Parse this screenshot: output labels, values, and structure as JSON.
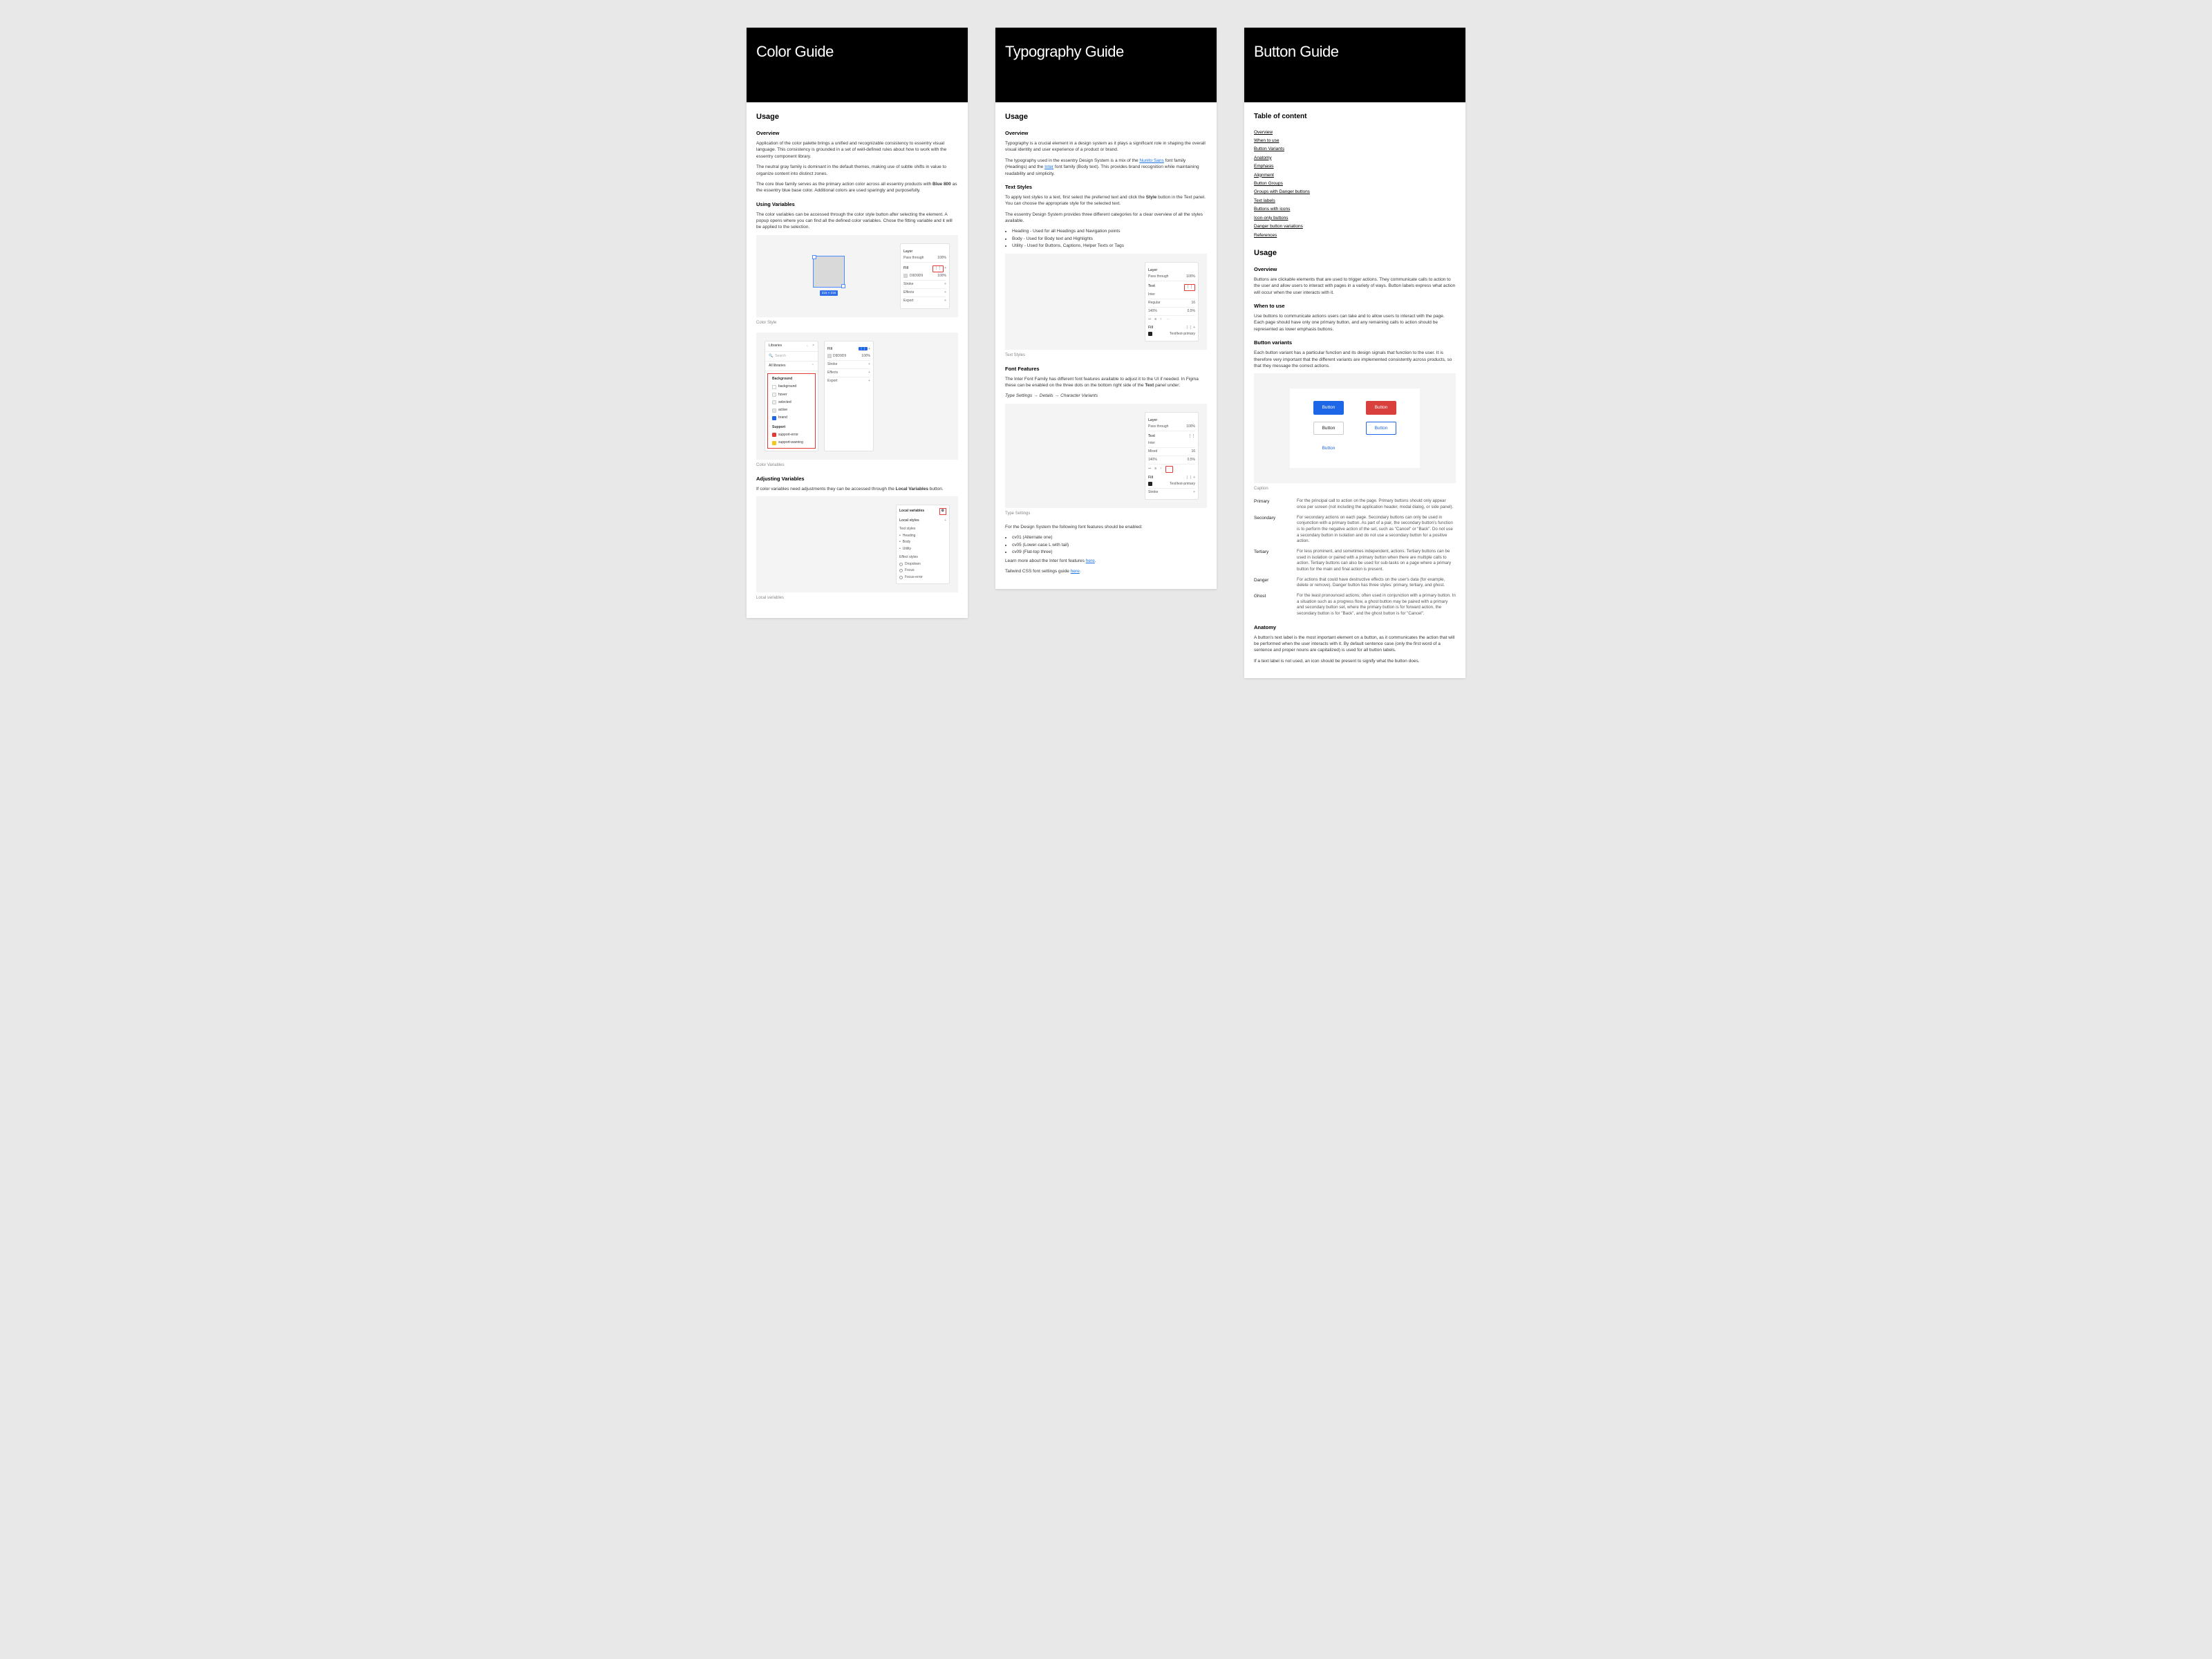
{
  "color": {
    "title": "Color Guide",
    "usage": "Usage",
    "overview_h": "Overview",
    "overview_p1": "Application of the color palette brings a unified and recognizable consistency to essentry visual language. This consistency is grounded in a set of well-defined rules about how to work with the essentry component library.",
    "overview_p2": "The neutral gray family is dominant in the default themes, making use of subtle shifts in value to organize content into distinct zones.",
    "overview_p3a": "The core blue family serves as the primary action color across all essentry products with ",
    "overview_p3b": "Blue 800",
    "overview_p3c": " as the essentry blue base color. Additional colors are used sparingly and purposefully.",
    "using_vars_h": "Using Variables",
    "using_vars_p": "The color variables can be accessed through the color style button after selecting the element. A popup opens where you can find all the defined color variables. Chose the fitting variable and it will be applied to the selection.",
    "panel1": {
      "layer": "Layer",
      "passthrough": "Pass through",
      "pct": "100%",
      "fill": "Fill",
      "hex": "D9D9D9",
      "stroke": "Stroke",
      "effects": "Effects",
      "export": "Export",
      "size": "216 × 216"
    },
    "cap1": "Color Style",
    "lib": {
      "tab1": "Libraries",
      "search": "Search",
      "all": "All libraries",
      "bg": "Background",
      "items": [
        "background",
        "hover",
        "selected",
        "active",
        "brand"
      ],
      "support": "Support",
      "s1": "support-error",
      "s2": "support-warning",
      "fill": "Fill",
      "stroke": "Stroke",
      "effects": "Effects",
      "export": "Export"
    },
    "cap2": "Color Variables",
    "adjust_h": "Adjusting Variables",
    "adjust_p_a": "If color variables need adjustments they can be accessed through the ",
    "adjust_p_b": "Local Variables",
    "adjust_p_c": " button.",
    "lv": {
      "title": "Local variables",
      "styles": "Local styles",
      "text": "Text styles",
      "t1": "Heading",
      "t2": "Body",
      "t3": "Utility",
      "eff": "Effect styles",
      "e1": "Dropdown",
      "e2": "Focus",
      "e3": "Focus-error"
    },
    "cap3": "Local variables"
  },
  "typo": {
    "title": "Typography Guide",
    "usage": "Usage",
    "overview_h": "Overview",
    "overview_p": "Typography is a crucial element in a design system as it plays a significant role in shaping the overall visual identity and user experience of a product or brand.",
    "p2a": "The typography used in the essentry Design System is a mix of the ",
    "p2_link1": "Nunito Sans",
    "p2b": " font family (Headings) and the ",
    "p2_link2": "Inter",
    "p2c": " font family (Body text). This provides brand recognition while maintaining readability and simplicity.",
    "textstyles_h": "Text Styles",
    "ts_p1a": "To apply text styles to a text, first select the preferred text and click the ",
    "ts_p1b": "Style",
    "ts_p1c": " button in the Text panel. You can choose the appropriate style for the selected text.",
    "ts_p2": "The essentry Design System provides three different categories for a clear overview of all the styles available.",
    "ts_li": [
      "Heading - Used for all Headings and Navigation points",
      "Body - Used for Body text and Highlights",
      "Utility - Used for Buttons, Captions, Helper Texts or Tags"
    ],
    "panel": {
      "layer": "Layer",
      "pass": "Pass through",
      "pct": "100%",
      "text": "Text",
      "font": "Inter",
      "weight": "Regular",
      "size": "16",
      "lh": "140%",
      "ls": "0,5%",
      "fill": "Fill",
      "fillName": "Text/text-primary",
      "stroke": "Stroke"
    },
    "cap1": "Text Styles",
    "ff_h": "Font Features",
    "ff_p1a": "The Inter Font Family has different font features available to adjust it to the UI if needed. In Figma these can be enabled on the three dots on the bottom right side of the ",
    "ff_p1b": "Text",
    "ff_p1c": " panel under:",
    "ff_path1": "Type Settings",
    "ff_path2": "Details",
    "ff_path3": "Character Variants",
    "cap2": "Type Settings",
    "ff_p2": "For the Design System the following font features should be enabled:",
    "ff_li": [
      "cv01 (Alternate one)",
      "cv05 (Lower-case L with tail)",
      "cv09 (Flat-top three)"
    ],
    "ff_learn_a": "Learn more about the Inter font features ",
    "ff_learn_link": "here",
    "ff_learn_b": ".",
    "ff_tw_a": "Tailwind CSS font settings guide ",
    "ff_tw_link": "here",
    "ff_tw_b": ".",
    "panel2": {
      "weight": "Mixed"
    }
  },
  "button": {
    "title": "Button Guide",
    "toc_h": "Table of content",
    "toc": [
      "Overview",
      "When to use",
      "Button Variants",
      "Anatomy",
      "Emphasis",
      "Alignment",
      "Button Groups",
      "Groups with Danger buttons",
      "Text labels",
      "Buttons with icons",
      "Icon-only buttons",
      "Danger button variations",
      "References"
    ],
    "usage": "Usage",
    "ov_h": "Overview",
    "ov_p": "Buttons are clickable elements that are used to trigger actions. They communicate calls to action to the user and allow users to interact with pages in a variety of ways. Button labels express what action will occur when the user interacts with it.",
    "when_h": "When to use",
    "when_p": "Use buttons to communicate actions users can take and to allow users to interact with the page. Each page should have only one primary button, and any remaining calls to action should be represented as lower emphasis buttons.",
    "bv_h": "Button variants",
    "bv_p": "Each button variant has a particular function and its design signals that function to the user. It is therefore very important that the different variants are implemented consistently across products, so that they message the correct actions.",
    "btn_label": "Button",
    "caption": "Caption",
    "defs": [
      {
        "t": "Primary",
        "d": "For the principal call to action on the page. Primary buttons should only appear once per screen (not including the application header, modal dialog, or side panel)."
      },
      {
        "t": "Secondary",
        "d": "For secondary actions on each page. Secondary buttons can only be used in conjunction with a primary button. As part of a pair, the secondary button's function is to perform the negative action of the set, such as \"Cancel\" or \"Back\". Do not use a secondary button in isolation and do not use a secondary button for a positive action."
      },
      {
        "t": "Tertiary",
        "d": "For less prominent, and sometimes independent, actions. Tertiary buttons can be used in isolation or paired with a primary button when there are multiple calls to action. Tertiary buttons can also be used for sub-tasks on a page where a primary button for the main and final action is present."
      },
      {
        "t": "Danger",
        "d": "For actions that could have destructive effects on the user's data (for example, delete or remove). Danger button has three styles: primary, tertiary, and ghost."
      },
      {
        "t": "Ghost",
        "d": "For the least pronounced actions; often used in conjunction with a primary button. In a situation such as a progress flow, a ghost button may be paired with a primary and secondary button set, where the primary button is for forward action, the secondary button is for \"Back\", and the ghost button is for \"Cancel\"."
      }
    ],
    "anatomy_h": "Anatomy",
    "anatomy_p": "A button's text label is the most important element on a button, as it communicates the action that will be performed when the user interacts with it. By default sentence case (only the first word of a sentence and proper nouns are capitalized) is used for all button labels.",
    "anatomy_p2": "If a text label is not used, an icon should be present to signify what the button does."
  }
}
